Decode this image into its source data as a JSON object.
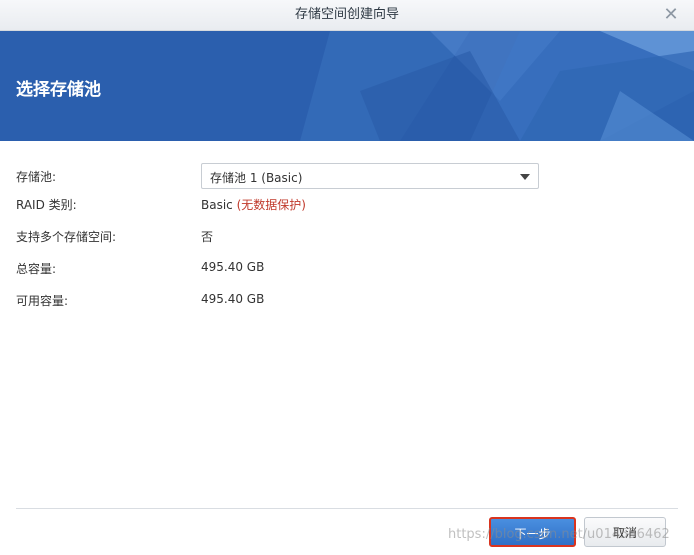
{
  "window": {
    "title": "存储空间创建向导",
    "close_symbol": "✕"
  },
  "banner": {
    "title": "选择存储池"
  },
  "form": {
    "storage_pool_label": "存储池:",
    "storage_pool_value": "存储池 1 (Basic)",
    "raid_label": "RAID 类别:",
    "raid_value": "Basic",
    "raid_note": "(无数据保护)",
    "multi_volume_label": "支持多个存储空间:",
    "multi_volume_value": "否",
    "total_capacity_label": "总容量:",
    "total_capacity_value": "495.40 GB",
    "available_capacity_label": "可用容量:",
    "available_capacity_value": "495.40 GB"
  },
  "footer": {
    "next_label": "下一步",
    "cancel_label": "取消",
    "watermark": "https://blog.csdn.net/u014556462"
  },
  "colors": {
    "banner": "#2b5fae",
    "primary_button": "#2f6fc6",
    "highlight_border": "#d9341f",
    "warning_text": "#c0392b"
  }
}
